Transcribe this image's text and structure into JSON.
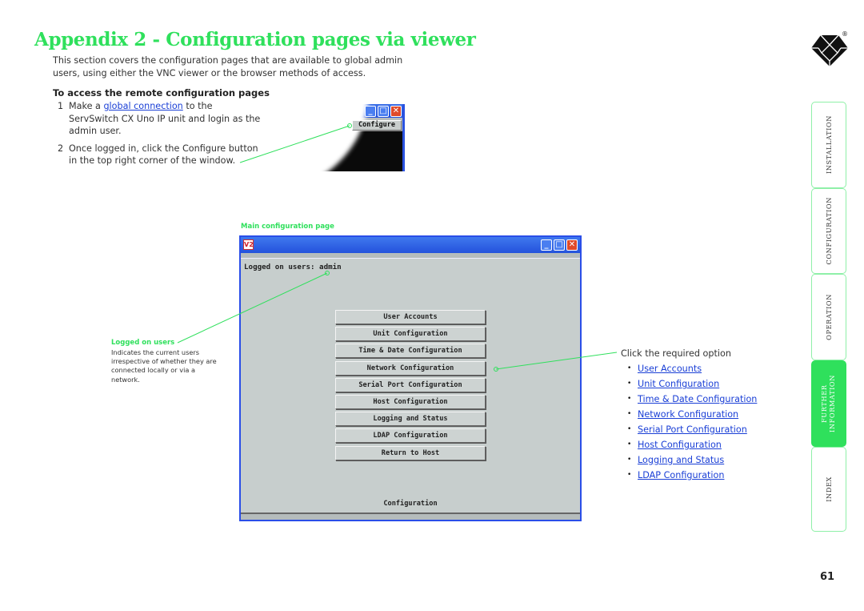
{
  "title": "Appendix 2 - Configuration pages via viewer",
  "intro": "This section covers the configuration pages that are available to global admin users, using either the VNC viewer or the browser methods of access.",
  "subhead": "To access the remote configuration pages",
  "steps": [
    {
      "num": "1",
      "pre": "Make a ",
      "link": "global connection",
      "post": " to the ServSwitch CX Uno IP unit and login as the admin user."
    },
    {
      "num": "2",
      "pre": "Once logged in, click the Configure button in the top right corner of the window.",
      "link": "",
      "post": ""
    }
  ],
  "crop_window": {
    "configure_label": "Configure",
    "minimize_glyph": "_",
    "maximize_glyph": "□",
    "close_glyph": "✕"
  },
  "main_caption": "Main configuration page",
  "logged_note": {
    "heading": "Logged on users",
    "text": "Indicates the current users irrespective of whether they are connected locally or via a network."
  },
  "main_window": {
    "icon_label": "V2",
    "minimize_glyph": "_",
    "maximize_glyph": "□",
    "close_glyph": "✕",
    "logged_users": "Logged on users:  admin",
    "buttons": [
      "User Accounts",
      "Unit Configuration",
      "Time & Date Configuration",
      "Network Configuration",
      "Serial Port Configuration",
      "Host Configuration",
      "Logging and Status",
      "LDAP Configuration",
      "Return to Host"
    ],
    "footer": "Configuration"
  },
  "options": {
    "intro": "Click the required option",
    "bullet": "•",
    "links": [
      "User Accounts",
      "Unit Configuration",
      "Time & Date Configuration",
      "Network Configuration",
      "Serial Port Configuration",
      "Host Configuration",
      "Logging and Status",
      "LDAP Configuration"
    ]
  },
  "side_tabs": [
    {
      "label": "INSTALLATION",
      "active": false
    },
    {
      "label": "CONFIGURATION",
      "active": false
    },
    {
      "label": "OPERATION",
      "active": false
    },
    {
      "label": "FURTHER INFORMATION",
      "active": true
    },
    {
      "label": "INDEX",
      "active": false
    }
  ],
  "logo": {
    "registered": "®"
  },
  "page_number": "61",
  "colors": {
    "accent_green": "#2fe05c",
    "link_blue": "#1a3fd6",
    "window_blue": "#2a4ee8",
    "window_grey": "#c7cecd"
  }
}
